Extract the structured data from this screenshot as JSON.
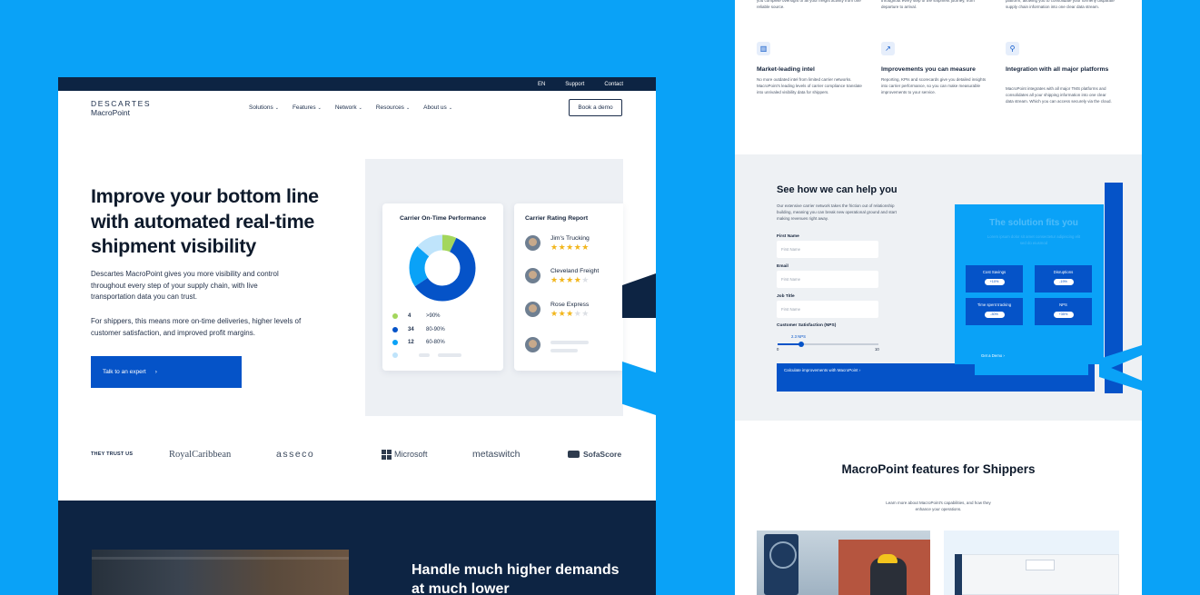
{
  "left": {
    "utility_nav": [
      "EN",
      "Support",
      "Contact"
    ],
    "logo": {
      "line1": "DESCARTES",
      "line2": "MacroPoint"
    },
    "nav": [
      "Solutions",
      "Features",
      "Network",
      "Resources",
      "About us"
    ],
    "book_demo": "Book a demo",
    "hero": {
      "title": "Improve your bottom line with automated real-time shipment visibility",
      "p1": "Descartes MacroPoint gives you more visibility and control throughout every step of your supply chain, with live transportation data you can trust.",
      "p2": "For shippers, this means more on-time deliveries, higher levels of customer satisfaction, and improved profit margins.",
      "cta": "Talk to an expert"
    },
    "on_time_card": {
      "title": "Carrier On-Time Performance",
      "donut": [
        {
          "value": 4,
          "color": "#a3d65c"
        },
        {
          "value": 34,
          "color": "#0553c8"
        },
        {
          "value": 12,
          "color": "#0aa2f7"
        },
        {
          "value": 8,
          "color": "#bfe4fb"
        }
      ],
      "legend": [
        {
          "count": "4",
          "range": ">90%",
          "color": "#a3d65c"
        },
        {
          "count": "34",
          "range": "80-90%",
          "color": "#0553c8"
        },
        {
          "count": "12",
          "range": "60-80%",
          "color": "#0aa2f7"
        }
      ]
    },
    "rating_card": {
      "title": "Carrier Rating Report",
      "carriers": [
        {
          "name": "Jim's Trucking",
          "rating": 5
        },
        {
          "name": "Cleveland Freight",
          "rating": 4
        },
        {
          "name": "Rose Express",
          "rating": 3
        }
      ]
    },
    "trust": {
      "label": "THEY TRUST US",
      "brands": [
        "RoyalCaribbean",
        "asseco",
        "Microsoft",
        "metaswitch",
        "SofaScore"
      ]
    },
    "bottom_title": "Handle much higher demands at much lower"
  },
  "right": {
    "top_fragments": [
      "you complete oversight of all your freight activity from one reliable source.",
      "throughout every step of the shipment journey, from departure to arrival.",
      "platform, allowing you to consolidate your formerly disparate supply chain information into one clear data stream."
    ],
    "features": [
      {
        "icon": "bar-chart-icon",
        "title": "Market-leading intel",
        "text": "No more outdated intel from limited carrier networks. MacroPoint's leading levels of carrier compliance translate into unrivaled visibility data for shippers."
      },
      {
        "icon": "trend-chart-icon",
        "title": "Improvements you can measure",
        "text": "Reporting, KPIs and scorecards give you detailed insights into carrier performance, so you can make measurable improvements to your service."
      },
      {
        "icon": "integration-icon",
        "title": "Integration with all major platforms",
        "text": "MacroPoint integrates with all major TMS platforms and consolidates all your shipping information into one clear data stream. Which you can access securely via the cloud."
      }
    ],
    "help": {
      "title": "See how we can help you",
      "text": "Our extensive carrier network takes the friction out of relationship building, meaning you can break new operational ground and start making revenues right away.",
      "fields": [
        {
          "label": "First Name",
          "placeholder": "First Name"
        },
        {
          "label": "Email",
          "placeholder": "First Name"
        },
        {
          "label": "Job Title",
          "placeholder": "First Name"
        }
      ],
      "nps_label": "Customer Satisfaction (NPS)",
      "nps_value": "2.3 NPS",
      "nps_level": 0.23,
      "slider_min": "0",
      "slider_max": "10",
      "calc": "Calculate improvements with MacroPoint"
    },
    "solution": {
      "title": "The solution fits you",
      "sub": "Lorem ipsum dolor sit amet consectetur adipiscing elit sed do eiusmod",
      "kpis": [
        {
          "label": "Cost Savings",
          "value": "+10%"
        },
        {
          "label": "Disruptions",
          "value": "-19%"
        },
        {
          "label": "Time spent tracking",
          "value": "-30%"
        },
        {
          "label": "NPS",
          "value": "+35%"
        }
      ],
      "demo": "Get a Demo"
    },
    "features_section": {
      "title": "MacroPoint features for Shippers",
      "sub": "Learn more about MacroPoint's capabilities, and how they enhance your operations."
    }
  }
}
